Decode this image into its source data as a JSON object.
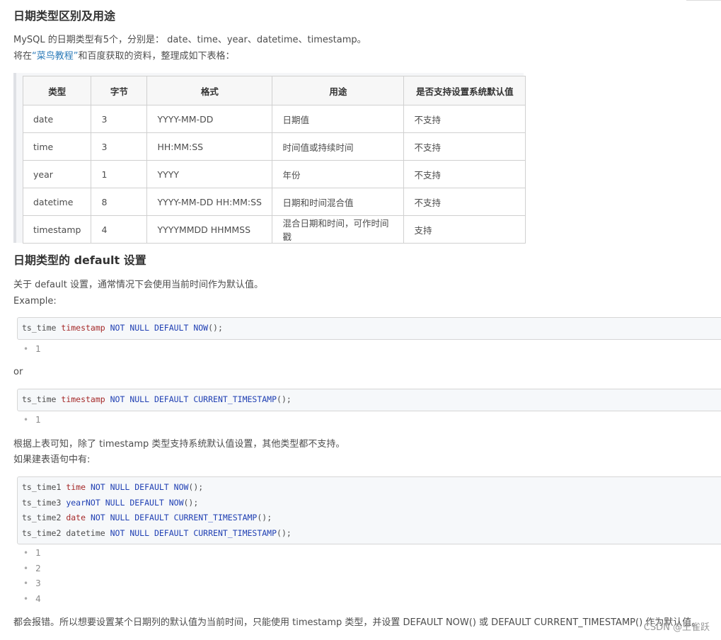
{
  "section1": {
    "title": "日期类型区别及用途",
    "intro": "MySQL 的日期类型有5个，分别是： date、time、year、datetime、timestamp。",
    "source_prefix": "将在",
    "source_link": "“菜鸟教程”",
    "source_suffix": "和百度获取的资料，整理成如下表格："
  },
  "table": {
    "headers": [
      "类型",
      "字节",
      "格式",
      "用途",
      "是否支持设置系统默认值"
    ],
    "rows": [
      [
        "date",
        "3",
        "YYYY-MM-DD",
        "日期值",
        "不支持"
      ],
      [
        "time",
        "3",
        "HH:MM:SS",
        "时间值或持续时间",
        "不支持"
      ],
      [
        "year",
        "1",
        "YYYY",
        "年份",
        "不支持"
      ],
      [
        "datetime",
        "8",
        "YYYY-MM-DD HH:MM:SS",
        "日期和时间混合值",
        "不支持"
      ],
      [
        "timestamp",
        "4",
        "YYYYMMDD HHMMSS",
        "混合日期和时间，可作时间戳",
        "支持"
      ]
    ]
  },
  "section2": {
    "title": "日期类型的 default 设置",
    "desc": "关于 default 设置，通常情况下会使用当前时间作为默认值。",
    "example_label": "Example:",
    "or_label": "or",
    "conclusion": "根据上表可知，除了 timestamp 类型支持系统默认值设置，其他类型都不支持。",
    "if_label": "如果建表语句中有:",
    "final": "都会报错。所以想要设置某个日期列的默认值为当前时间，只能使用 timestamp 类型，并设置 DEFAULT NOW() 或 DEFAULT CURRENT_TIMESTAMP() 作为默认值。"
  },
  "code1": {
    "col": "ts_time ",
    "type": "timestamp",
    "kws": " NOT NULL DEFAULT ",
    "func": "NOW",
    "tail": "();",
    "line_numbers": [
      "1"
    ]
  },
  "code2": {
    "col": "ts_time ",
    "type": "timestamp",
    "kws": " NOT NULL DEFAULT ",
    "func": "CURRENT_TIMESTAMP",
    "tail": "();",
    "line_numbers": [
      "1"
    ]
  },
  "code3": {
    "lines": [
      {
        "col": "ts_time1 ",
        "type": "time",
        "kws": " NOT NULL DEFAULT ",
        "func": "NOW",
        "tail": "();"
      },
      {
        "col": "ts_time3 ",
        "type": "yearNOT",
        "kws": " NULL DEFAULT ",
        "func": "NOW",
        "tail": "();"
      },
      {
        "col": "ts_time2 ",
        "type": "date",
        "kws": " NOT NULL DEFAULT ",
        "func": "CURRENT_TIMESTAMP",
        "tail": "();"
      },
      {
        "col": "ts_time2 ",
        "type": "datetime",
        "kws": " NOT NULL DEFAULT ",
        "func": "CURRENT_TIMESTAMP",
        "tail": "();"
      }
    ],
    "line_numbers": [
      "1",
      "2",
      "3",
      "4"
    ]
  },
  "watermark": "CSDN @王雀跃",
  "colors": {
    "keyword": "#1f3fb3",
    "type": "#a52a2a",
    "link": "#2a7ab8"
  }
}
